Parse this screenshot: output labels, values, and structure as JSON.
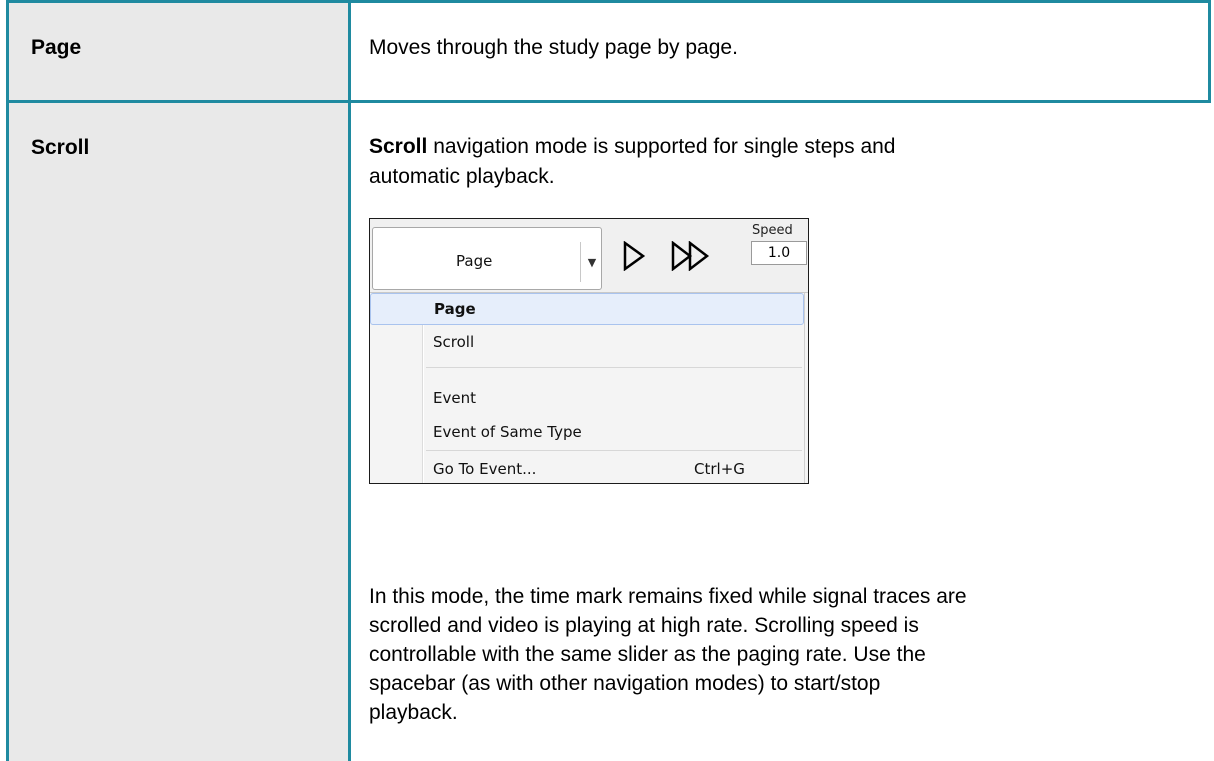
{
  "rows": [
    {
      "label": "Page",
      "description": "Moves through the study page by page."
    },
    {
      "label": "Scroll",
      "intro_bold": "Scroll",
      "intro_rest_1": " navigation mode is supported for single steps and",
      "intro_rest_2": "automatic playback.",
      "body_lines": [
        "In this mode, the time mark remains fixed while signal traces are",
        "scrolled and video is playing at high rate. Scrolling speed is",
        "controllable with the same slider as the paging rate. Use the",
        "spacebar (as with other navigation modes) to start/stop",
        "playback."
      ]
    }
  ],
  "screenshot": {
    "combo_value": "Page",
    "speed_label": "Speed",
    "speed_value": "1.0",
    "menu_items": [
      {
        "label": "Page",
        "accel": "",
        "selected": true
      },
      {
        "label": "Scroll",
        "accel": "",
        "selected": false
      },
      {
        "label": "Event",
        "accel": "",
        "selected": false
      },
      {
        "label": "Event of Same Type",
        "accel": "",
        "selected": false
      },
      {
        "label": "Go To Event...",
        "accel": "Ctrl+G",
        "selected": false
      }
    ]
  },
  "colors": {
    "table_border": "#1f8aa0",
    "label_column_bg": "#e9e9e9",
    "menu_highlight": "#e6eefb"
  }
}
